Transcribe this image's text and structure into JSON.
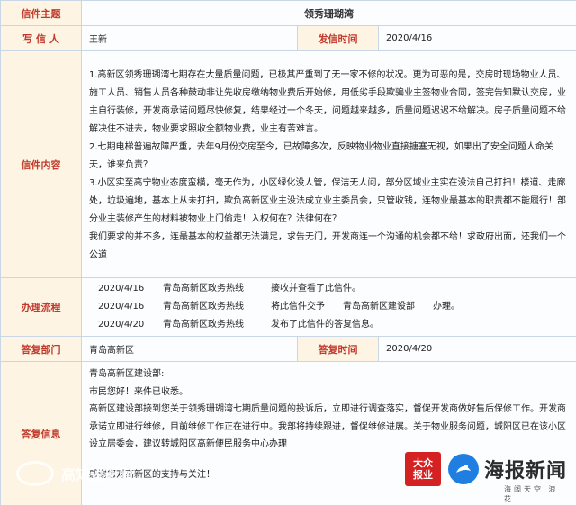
{
  "rows": {
    "subject": {
      "label": "信件主题",
      "value": "领秀珊瑚湾"
    },
    "writer": {
      "label": "写 信 人",
      "value": "王新",
      "date_label": "发信时间",
      "date_value": "2020/4/16"
    },
    "content": {
      "label": "信件内容",
      "paragraphs": [
        "1.高新区领秀珊瑚湾七期存在大量质量问题，已极其严重到了无一家不修的状况。更为可恶的是，交房时现场物业人员、施工人员、销售人员各种鼓动非让先收房缴纳物业费后开始修，用低劣手段欺骗业主签物业合同，签完告知默认交房，业主自行装修，开发商承诺问题尽快修复，结果经过一个冬天，问题越来越多，质量问题迟迟不给解决。房子质量问题不给解决住不进去，物业要求照收全额物业费，业主有苦难言。",
        "2.七期电梯普遍故障严重，去年9月份交房至今，已故障多次，反映物业物业直接搪塞无视，如果出了安全问题人命关天，谁来负责？",
        "3.小区实至高宁物业态度蛮横，毫无作为，小区绿化没人管，保洁无人问，部分区域业主实在没法自己打扫！楼道、走廊处，垃圾遍地，基本上从未打扫，欺负高新区业主没法成立业主委员会，只管收钱，连物业最基本的职责都不能履行！部分业主装修产生的材料被物业上门偷走！入权何在？法律何在？",
        "我们要求的并不多，连最基本的权益都无法满足，求告无门，开发商连一个沟通的机会都不给！求政府出面，还我们一个公道"
      ]
    },
    "process": {
      "label": "办理流程",
      "entries": [
        {
          "date": "2020/4/16",
          "org": "青岛高新区政务热线",
          "text": "接收并查看了此信件。"
        },
        {
          "date": "2020/4/16",
          "org": "青岛高新区政务热线",
          "text": "将此信件交予　　青岛高新区建设部　　办理。"
        },
        {
          "date": "2020/4/20",
          "org": "青岛高新区政务热线",
          "text": "发布了此信件的答复信息。"
        }
      ]
    },
    "dept": {
      "label": "答复部门",
      "value": "青岛高新区",
      "date_label": "答复时间",
      "date_value": "2020/4/20"
    },
    "reply": {
      "label": "答复信息",
      "paragraphs": [
        "青岛高新区建设部:",
        "市民您好！来件已收悉。",
        "高新区建设部接到您关于领秀珊瑚湾七期质量问题的投诉后，立即进行调查落实，督促开发商做好售后保修工作。开发商承诺立即进行维修，目前维修工作正在进行中。我部将持续跟进，督促维修进展。关于物业服务问题，城阳区已在该小区设立居委会，建议转城阳区高新便民服务中心办理",
        "",
        "感谢您对高新区的支持与关注！"
      ]
    }
  },
  "watermarks": {
    "left_text": "高知说新闻",
    "right_badge": "大众报业",
    "right_brand": "海报新闻",
    "right_sub": "海阔天空 浪花"
  }
}
